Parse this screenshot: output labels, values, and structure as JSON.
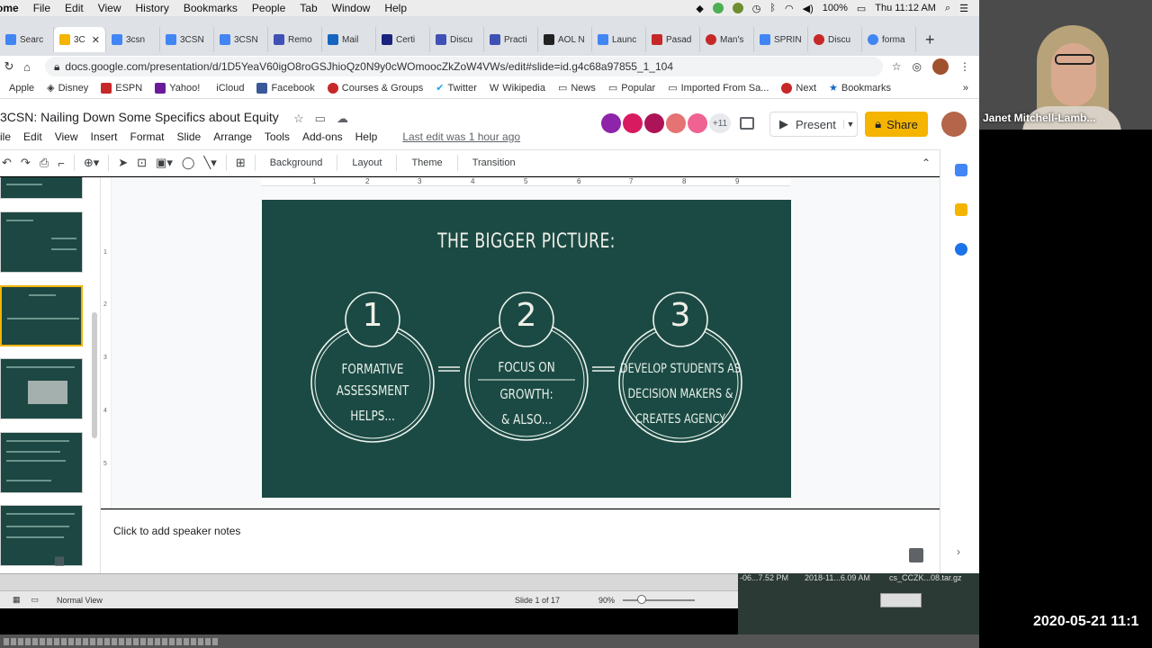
{
  "menubar": {
    "app_name": "ome",
    "items": [
      "File",
      "Edit",
      "View",
      "History",
      "Bookmarks",
      "People",
      "Tab",
      "Window",
      "Help"
    ],
    "battery": "100%",
    "clock": "Thu 11:12 AM"
  },
  "tabs": [
    {
      "label": "Searc",
      "color": "#4285f4"
    },
    {
      "label": "3C",
      "color": "#f4b400",
      "active": true
    },
    {
      "label": "3csn",
      "color": "#4285f4"
    },
    {
      "label": "3CSN",
      "color": "#4285f4"
    },
    {
      "label": "3CSN",
      "color": "#4285f4"
    },
    {
      "label": "Remo",
      "color": "#3f51b5"
    },
    {
      "label": "Mail",
      "color": "#1565c0"
    },
    {
      "label": "Certi",
      "color": "#1a237e"
    },
    {
      "label": "Discu",
      "color": "#3f51b5"
    },
    {
      "label": "Practi",
      "color": "#3f51b5"
    },
    {
      "label": "AOL N",
      "color": "#222222"
    },
    {
      "label": "Launc",
      "color": "#4285f4"
    },
    {
      "label": "Pasad",
      "color": "#c62828"
    },
    {
      "label": "Man's",
      "color": "#c62828"
    },
    {
      "label": "SPRIN",
      "color": "#4285f4"
    },
    {
      "label": "Discu",
      "color": "#c62828"
    },
    {
      "label": "forma",
      "color": "#4285f4"
    }
  ],
  "address": {
    "url": "docs.google.com/presentation/d/1D5YeaV60igO8roGSJhioQz0N9y0cWOmoocZkZoW4VWs/edit#slide=id.g4c68a97855_1_104"
  },
  "bookmarks": [
    "Apple",
    "Disney",
    "ESPN",
    "Yahoo!",
    "iCloud",
    "Facebook",
    "Courses & Groups",
    "Twitter",
    "Wikipedia",
    "News",
    "Popular",
    "Imported From Sa...",
    "Next",
    "Bookmarks"
  ],
  "doc": {
    "title": "3CSN: Nailing Down Some Specifics about Equity",
    "menu": [
      "ile",
      "Edit",
      "View",
      "Insert",
      "Format",
      "Slide",
      "Arrange",
      "Tools",
      "Add-ons",
      "Help"
    ],
    "last_edit": "Last edit was 1 hour ago",
    "collab_more": "+11",
    "present_label": "Present",
    "share_label": "Share"
  },
  "toolbar": {
    "background": "Background",
    "layout": "Layout",
    "theme": "Theme",
    "transition": "Transition"
  },
  "ruler": {
    "h": [
      "1",
      "2",
      "3",
      "4",
      "5",
      "6",
      "7",
      "8",
      "9"
    ],
    "v": [
      "1",
      "2",
      "3",
      "4",
      "5"
    ]
  },
  "slide": {
    "title": "THE BIGGER PICTURE:",
    "circles": [
      {
        "num": "1",
        "lines": [
          "FORMATIVE",
          "ASSESSMENT",
          "HELPS..."
        ]
      },
      {
        "num": "2",
        "lines": [
          "FOCUS ON",
          "GROWTH:",
          "& ALSO..."
        ]
      },
      {
        "num": "3",
        "lines": [
          "DEVELOP STUDENTS AS",
          "DECISION MAKERS &",
          "CREATES AGENCY"
        ]
      }
    ]
  },
  "notes": {
    "placeholder": "Click to add speaker notes"
  },
  "bottom_window": {
    "view": "Normal View",
    "slide_indicator": "Slide 1 of 17",
    "zoom": "90%"
  },
  "desktop_labels": [
    "-06...7.52 PM",
    "2018-11...6.09 AM",
    "cs_CCZK...08.tar.gz"
  ],
  "video": {
    "participant": "Janet Mitchell-Lamb..."
  },
  "timestamp": "2020-05-21 11:1"
}
